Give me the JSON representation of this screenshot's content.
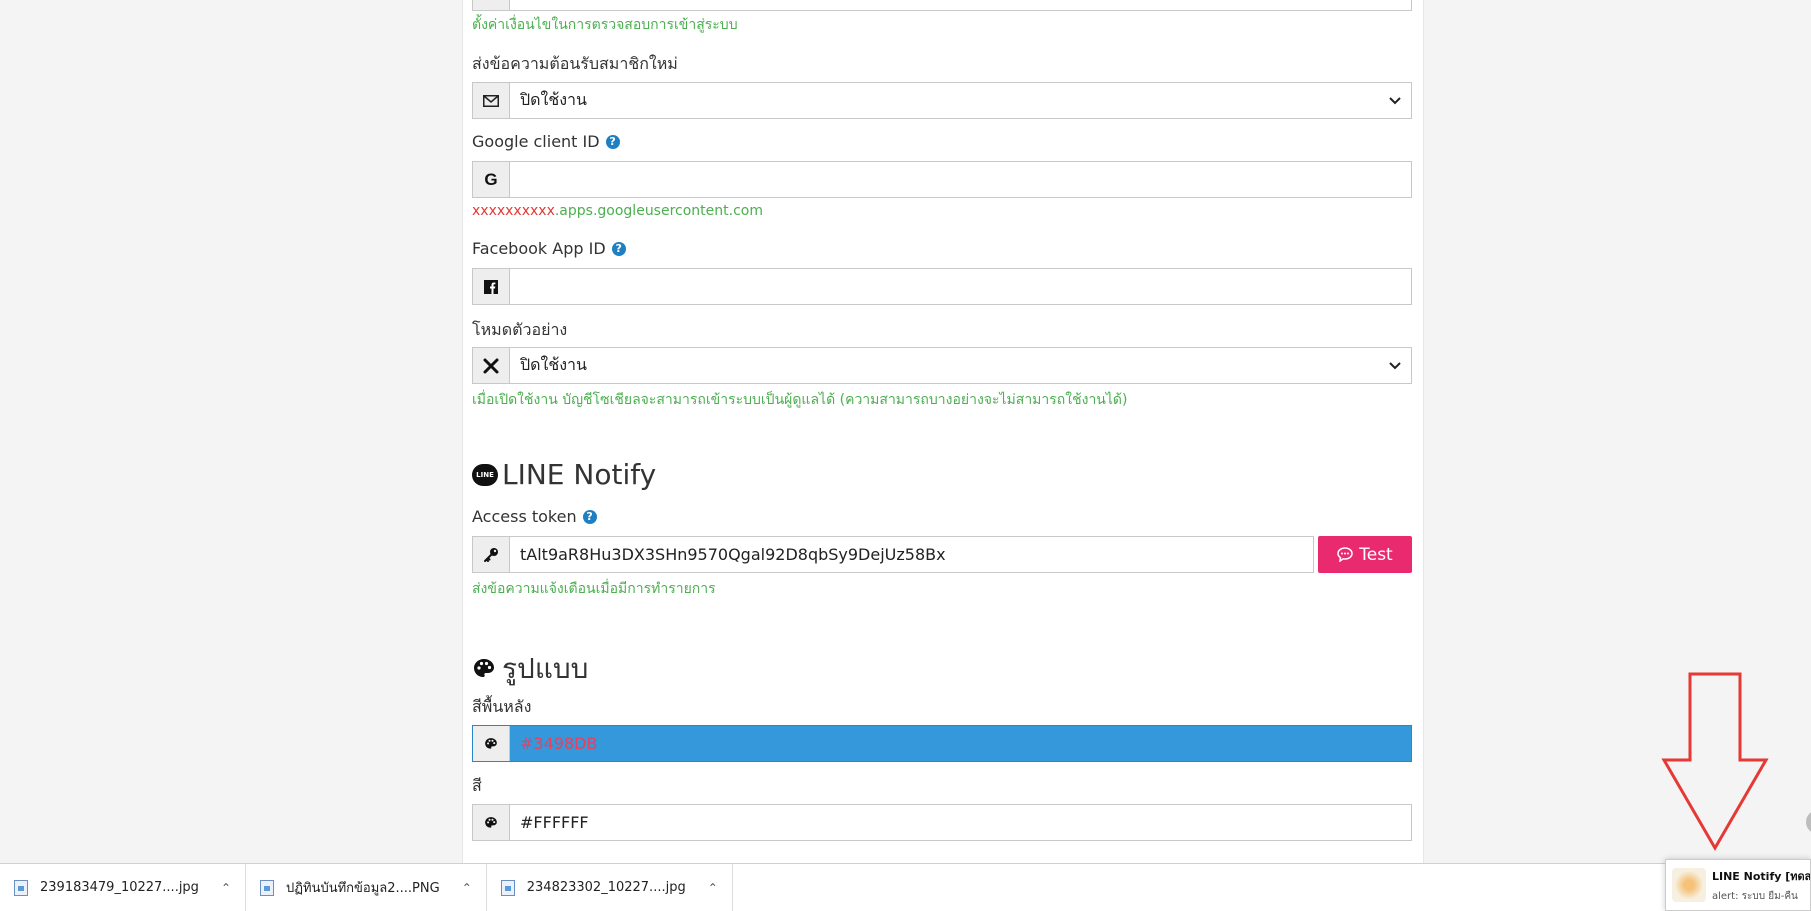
{
  "settings": {
    "login_hint": "ตั้งค่าเงื่อนไขในการตรวจสอบการเข้าสู่ระบบ",
    "welcome": {
      "label": "ส่งข้อความต้อนรับสมาชิกใหม่",
      "value": "ปิดใช้งาน",
      "icon": "envelope-icon"
    },
    "google": {
      "label": "Google client ID",
      "value": "",
      "hint_red": "xxxxxxxxxx",
      "hint_green": ".apps.googleusercontent.com",
      "icon": "google-icon"
    },
    "facebook": {
      "label": "Facebook App ID",
      "value": "",
      "icon": "facebook-icon"
    },
    "demo": {
      "label": "โหมดตัวอย่าง",
      "value": "ปิดใช้งาน",
      "hint": "เมื่อเปิดใช้งาน บัญชีโซเชียลจะสามารถเข้าระบบเป็นผู้ดูแลได้ (ความสามารถบางอย่างจะไม่สามารถใช้งานได้)",
      "icon": "tools-icon"
    }
  },
  "line_notify": {
    "title": "LINE Notify",
    "token_label": "Access token",
    "token_value": "tAlt9aR8Hu3DX3SHn9570Qgal92D8qbSy9DejUz58Bx",
    "test_button": "Test",
    "hint": "ส่งข้อความแจ้งเตือนเมื่อมีการทำรายการ",
    "logo_text": "LINE"
  },
  "style": {
    "title": "รูปแบบ",
    "bg_label": "สีพื้นหลัง",
    "bg_value": "#3498DB",
    "color_label": "สี",
    "color_value": "#FFFFFF"
  },
  "colors": {
    "bg_field": "#3498DB",
    "bg_text": "#e8405f",
    "accent_button": "#ea2a6e",
    "hint_green": "#4caf50"
  },
  "downloads": [
    {
      "name": "239183479_10227....jpg"
    },
    {
      "name": "ปฏิทินบันทึกข้อมูล2....PNG"
    },
    {
      "name": "234823302_10227....jpg"
    }
  ],
  "notification": {
    "title": "LINE Notify [ทดสอบ]",
    "text": "alert: ระบบ ยืม-คืน"
  }
}
